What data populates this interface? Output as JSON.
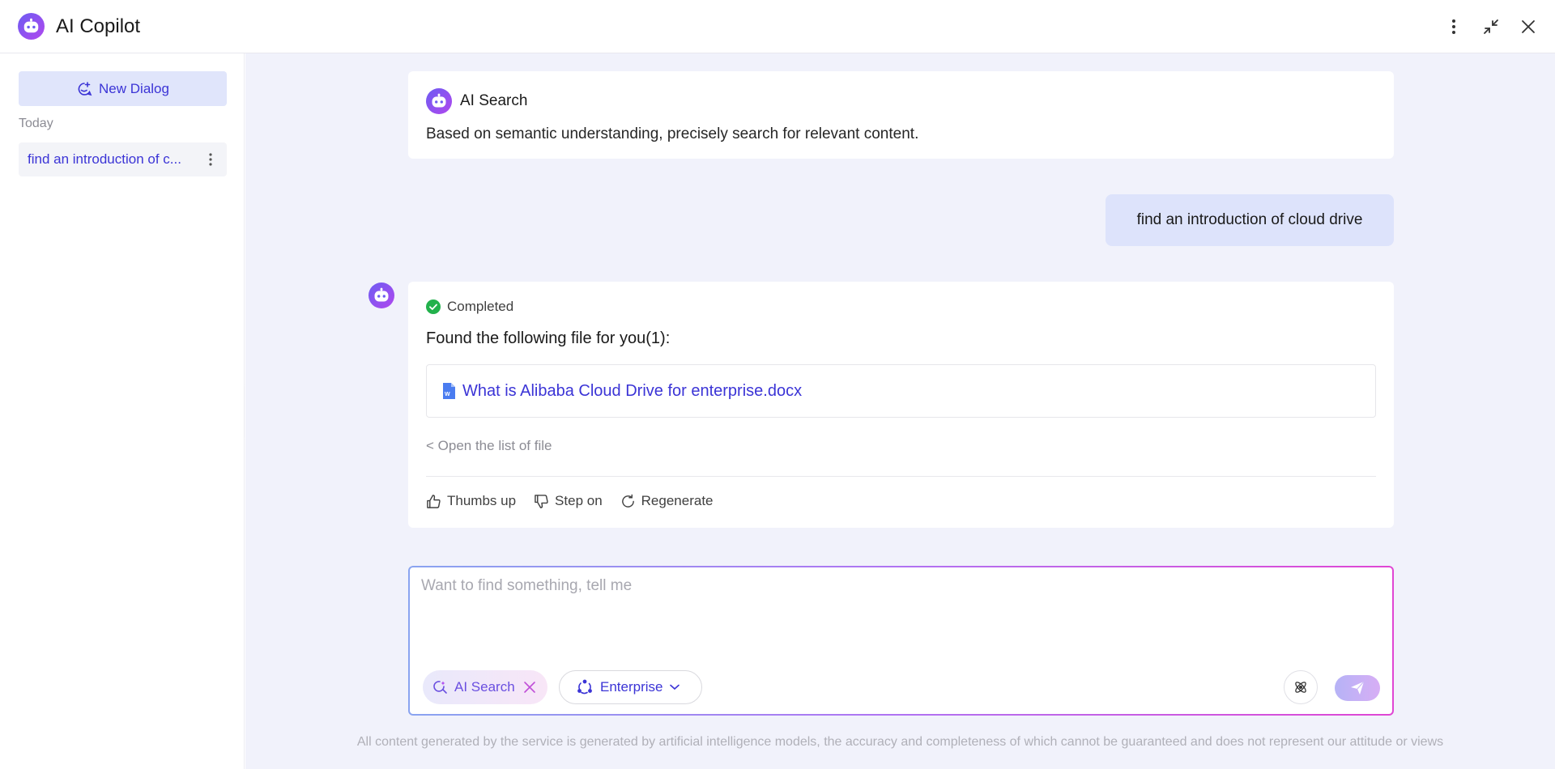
{
  "window": {
    "title": "AI Copilot",
    "logo_icon": "robot-icon",
    "actions": [
      "more-vertical-icon",
      "collapse-window-icon",
      "close-icon"
    ]
  },
  "sidebar": {
    "new_dialog_label": "New Dialog",
    "group_label": "Today",
    "history": [
      {
        "label": "find an introduction of c..."
      }
    ]
  },
  "intro": {
    "title": "AI Search",
    "description": "Based on semantic understanding, precisely search for relevant content."
  },
  "user_message": "find an introduction of cloud drive",
  "reply": {
    "status": "Completed",
    "text": "Found the following file for you(1):",
    "file_name": "What is Alibaba Cloud Drive for enterprise.docx",
    "open_list": "< Open the list of file",
    "feedback": {
      "thumbs_up": "Thumbs up",
      "step_on": "Step on",
      "regenerate": "Regenerate"
    }
  },
  "composer": {
    "placeholder": "Want to find something, tell me",
    "chip_search": "AI Search",
    "chip_enterprise": "Enterprise"
  },
  "disclaimer": "All content generated by the service is generated by artificial intelligence models, the accuracy and completeness of which cannot be guaranteed and does not represent our attitude or views",
  "colors": {
    "accent": "#3b34d6",
    "background": "#f1f2fb",
    "success": "#22b14c"
  }
}
